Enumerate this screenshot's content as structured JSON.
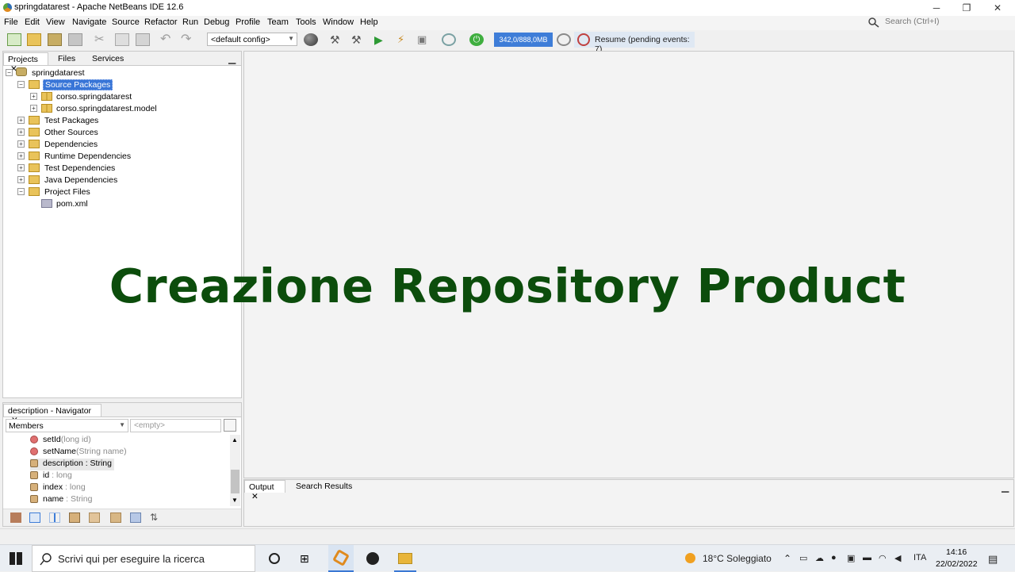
{
  "window": {
    "title": "springdatarest - Apache NetBeans IDE 12.6"
  },
  "menu": [
    "File",
    "Edit",
    "View",
    "Navigate",
    "Source",
    "Refactor",
    "Run",
    "Debug",
    "Profile",
    "Team",
    "Tools",
    "Window",
    "Help"
  ],
  "search": {
    "placeholder": "Search (Ctrl+I)"
  },
  "toolbar": {
    "config": "<default config>",
    "memory": "342,0/888,0MB",
    "resume": "Resume (pending events: 7)"
  },
  "projects_panel": {
    "tabs": [
      "Projects",
      "Files",
      "Services"
    ],
    "tree": {
      "root": "springdatarest",
      "source_packages": "Source Packages",
      "packages": [
        "corso.springdatarest",
        "corso.springdatarest.model"
      ],
      "nodes": [
        "Test Packages",
        "Other Sources",
        "Dependencies",
        "Runtime Dependencies",
        "Test Dependencies",
        "Java Dependencies"
      ],
      "project_files": "Project Files",
      "pom": "pom.xml"
    }
  },
  "navigator": {
    "title": "description - Navigator",
    "members_label": "Members",
    "filter_placeholder": "<empty>",
    "items": [
      {
        "name": "setId",
        "detail": "(long id)"
      },
      {
        "name": "setName",
        "detail": "(String name)"
      },
      {
        "name": "description",
        "detail": " : String"
      },
      {
        "name": "id",
        "detail": " : long"
      },
      {
        "name": "index",
        "detail": " : long"
      },
      {
        "name": "name",
        "detail": " : String"
      }
    ]
  },
  "overlay_text": "Creazione Repository Product",
  "output_tabs": [
    "Output",
    "Search Results"
  ],
  "taskbar": {
    "search_placeholder": "Scrivi qui per eseguire la ricerca",
    "weather": "18°C Soleggiato",
    "language": "ITA",
    "time": "14:16",
    "date": "22/02/2022"
  }
}
